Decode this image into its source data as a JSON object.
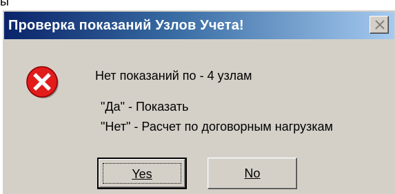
{
  "window": {
    "title": "Проверка показаний Узлов Учета!"
  },
  "top_fragment": {
    "text": "ы"
  },
  "message": {
    "line1": "Нет показаний по  -  4  узлам",
    "line2": "\"Да\"  - Показать",
    "line3": "\"Нет\" - Расчет по договорным нагрузкам"
  },
  "buttons": {
    "yes_label": "Yes",
    "no_label": "No"
  },
  "icons": {
    "dialog_icon": "error-icon",
    "close_icon": "close-icon"
  },
  "colors": {
    "titlebar_start": "#0a246a",
    "titlebar_end": "#a6caf0",
    "dialog_bg": "#d4d0c8",
    "error_red": "#e21b1b"
  }
}
